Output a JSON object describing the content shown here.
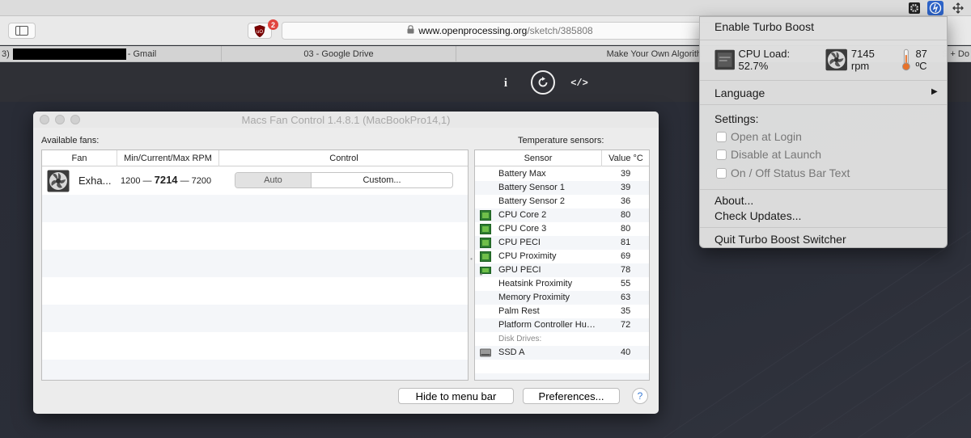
{
  "browser": {
    "url_host": "www.openprocessing.org",
    "url_path": "/sketch/385808",
    "extension_badge": "2",
    "tabs": [
      {
        "prefix": "3)",
        "label": "- Gmail"
      },
      {
        "label": "03 - Google Drive"
      },
      {
        "label": "Make Your Own Algorith"
      },
      {
        "label": "S + Do"
      }
    ]
  },
  "page_header": {
    "info_label": "i",
    "code_label": "</>"
  },
  "mfc": {
    "title": "Macs Fan Control 1.4.8.1 (MacBookPro14,1)",
    "fans_label": "Available fans:",
    "temps_label": "Temperature sensors:",
    "fan_headers": {
      "fan": "Fan",
      "rpm": "Min/Current/Max RPM",
      "control": "Control"
    },
    "fan": {
      "name": "Exha...",
      "min": "1200",
      "current": "7214",
      "max": "7200",
      "dash": "—"
    },
    "control": {
      "auto": "Auto",
      "custom": "Custom..."
    },
    "temp_headers": {
      "sensor": "Sensor",
      "value": "Value °C"
    },
    "sensors": [
      {
        "name": "Battery Max",
        "value": "39",
        "icon": "none"
      },
      {
        "name": "Battery Sensor 1",
        "value": "39",
        "icon": "none"
      },
      {
        "name": "Battery Sensor 2",
        "value": "36",
        "icon": "none"
      },
      {
        "name": "CPU Core 2",
        "value": "80",
        "icon": "cpu"
      },
      {
        "name": "CPU Core 3",
        "value": "80",
        "icon": "cpu"
      },
      {
        "name": "CPU PECI",
        "value": "81",
        "icon": "cpu"
      },
      {
        "name": "CPU Proximity",
        "value": "69",
        "icon": "cpu"
      },
      {
        "name": "GPU PECI",
        "value": "78",
        "icon": "gpu"
      },
      {
        "name": "Heatsink Proximity",
        "value": "55",
        "icon": "none"
      },
      {
        "name": "Memory Proximity",
        "value": "63",
        "icon": "none"
      },
      {
        "name": "Palm Rest",
        "value": "35",
        "icon": "none"
      },
      {
        "name": "Platform Controller Hub Die",
        "value": "72",
        "icon": "none"
      }
    ],
    "disk_group_label": "Disk Drives:",
    "disk": {
      "name": "SSD A",
      "value": "40"
    },
    "hide_button": "Hide to menu bar",
    "prefs_button": "Preferences...",
    "help_button": "?"
  },
  "turbo_menu": {
    "enable": "Enable Turbo Boost",
    "cpu_load": "CPU Load: 52.7%",
    "fan_rpm": "7145 rpm",
    "temperature": "87 ºC",
    "language": "Language",
    "settings": "Settings:",
    "open_at_login": "Open at Login",
    "disable_at_launch": "Disable at Launch",
    "status_bar_text": "On / Off Status Bar Text",
    "about": "About...",
    "check_updates": "Check Updates...",
    "quit": "Quit Turbo Boost Switcher"
  }
}
